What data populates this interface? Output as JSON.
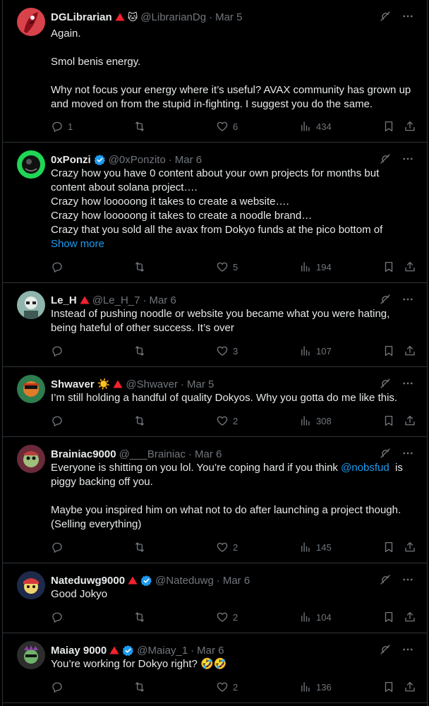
{
  "tweets": [
    {
      "name": "DGLibrarian",
      "handle": "@LibrarianDg",
      "date": "Mar 5",
      "emoji": "🐱",
      "lines": [
        "Again.",
        "",
        "Smol benis energy.",
        "",
        "Why not focus your energy where it’s useful? AVAX community has grown up and moved on from the stupid in-fighting. I suggest you do the same."
      ],
      "replies": "1",
      "reposts": "",
      "likes": "6",
      "views": "434"
    },
    {
      "name": "0xPonzi",
      "handle": "@0xPonzito",
      "date": "Mar 6",
      "lines": [
        "Crazy how you have 0 content about your own projects for months but content about solana project….",
        "Crazy how looooong it takes to create a website….",
        "Crazy how looooong it takes to create a noodle brand…",
        "Crazy that you sold all the avax from Dokyo funds at the pico bottom of"
      ],
      "show_more": "Show more",
      "replies": "",
      "reposts": "",
      "likes": "5",
      "views": "194"
    },
    {
      "name": "Le_H",
      "handle": "@Le_H_7",
      "date": "Mar 6",
      "lines": [
        "Instead of pushing noodle or website you became what you were hating, being hateful of other success. It’s over"
      ],
      "replies": "",
      "reposts": "",
      "likes": "3",
      "views": "107"
    },
    {
      "name": "Shwaver",
      "handle": "@Shwaver",
      "date": "Mar 5",
      "emoji": "☀️",
      "lines": [
        "I’m still holding a handful of quality Dokyos. Why you gotta do me like this."
      ],
      "replies": "",
      "reposts": "",
      "likes": "2",
      "views": "308"
    },
    {
      "name": "Brainiac9000",
      "handle": "@___Brainiac",
      "date": "Mar 6",
      "line1_pre": "Everyone is shitting on you lol. You’re coping hard if you think ",
      "mention": "@nobsfud",
      "line1_post": "  is piggy backing off you.",
      "lines": [
        "",
        "Maybe you inspired him on what not to do after launching a project though. (Selling everything)"
      ],
      "replies": "",
      "reposts": "",
      "likes": "2",
      "views": "145"
    },
    {
      "name": "Nateduwg9000",
      "handle": "@Nateduwg",
      "date": "Mar 6",
      "lines": [
        "Good Jokyo"
      ],
      "replies": "",
      "reposts": "",
      "likes": "2",
      "views": "104"
    },
    {
      "name": "Maiay 9000",
      "handle": "@Maiay_1",
      "date": "Mar 6",
      "lines": [
        "You’re working for Dokyo right? 🤣🤣"
      ],
      "replies": "",
      "reposts": "",
      "likes": "2",
      "views": "136"
    }
  ],
  "colors": {
    "accent": "#1d9bf0",
    "muted": "#71767b",
    "warning": "#f4212e",
    "verified": "#1d9bf0"
  }
}
